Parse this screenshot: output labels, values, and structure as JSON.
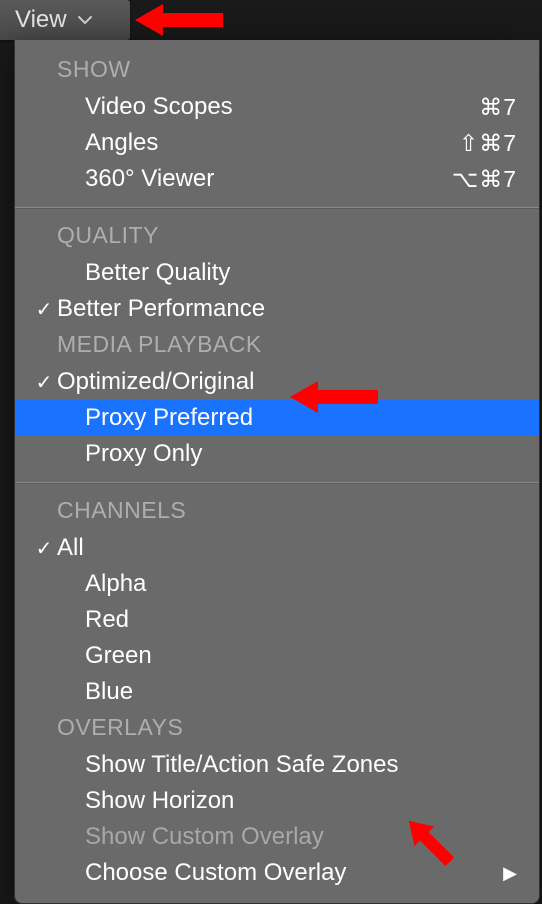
{
  "viewButton": {
    "label": "View"
  },
  "sections": {
    "show": {
      "header": "SHOW",
      "items": [
        {
          "label": "Video Scopes",
          "shortcut": "⌘7"
        },
        {
          "label": "Angles",
          "shortcut": "⇧⌘7"
        },
        {
          "label": "360° Viewer",
          "shortcut": "⌥⌘7"
        }
      ]
    },
    "quality": {
      "header": "QUALITY",
      "items": [
        {
          "label": "Better Quality"
        },
        {
          "label": "Better Performance"
        }
      ]
    },
    "mediaPlayback": {
      "header": "MEDIA PLAYBACK",
      "items": [
        {
          "label": "Optimized/Original"
        },
        {
          "label": "Proxy Preferred"
        },
        {
          "label": "Proxy Only"
        }
      ]
    },
    "channels": {
      "header": "CHANNELS",
      "items": [
        {
          "label": "All"
        },
        {
          "label": "Alpha"
        },
        {
          "label": "Red"
        },
        {
          "label": "Green"
        },
        {
          "label": "Blue"
        }
      ]
    },
    "overlays": {
      "header": "OVERLAYS",
      "items": [
        {
          "label": "Show Title/Action Safe Zones"
        },
        {
          "label": "Show Horizon"
        },
        {
          "label": "Show Custom Overlay"
        },
        {
          "label": "Choose Custom Overlay"
        }
      ]
    }
  }
}
